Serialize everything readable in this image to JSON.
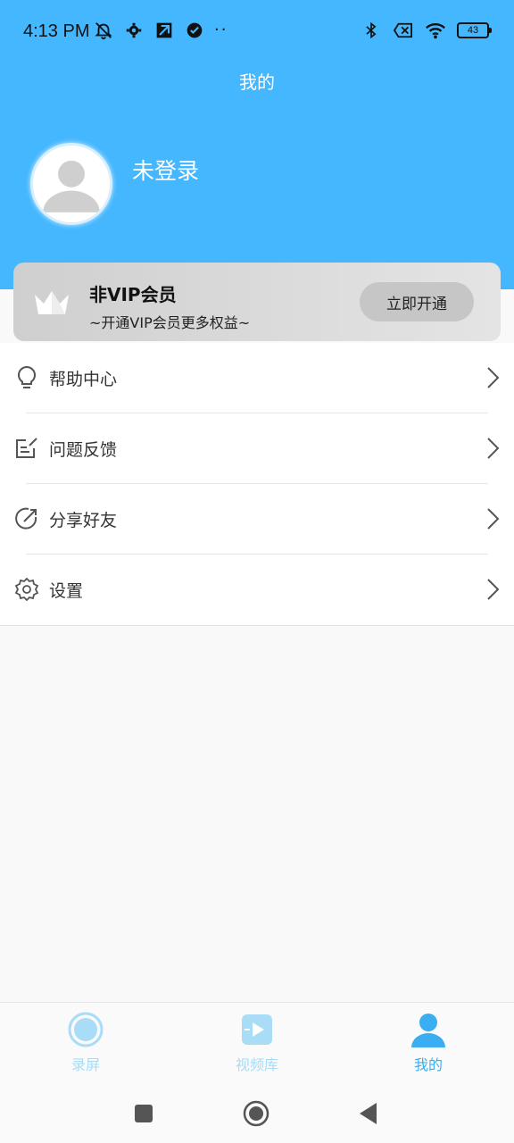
{
  "status_bar": {
    "time": "4:13 PM",
    "left_icons": [
      "muted-bell-icon",
      "gear-icon",
      "app-icon",
      "check-badge-icon"
    ],
    "dots": "··",
    "right_icons": [
      "bluetooth-icon",
      "sim-off-icon",
      "wifi-icon"
    ],
    "battery": "43"
  },
  "header": {
    "title": "我的",
    "background_color": "#44b7ff"
  },
  "profile": {
    "login_label": "未登录"
  },
  "vip": {
    "title": "非VIP会员",
    "subtitle": "~开通VIP会员更多权益~",
    "button_label": "立即开通"
  },
  "menu": {
    "items": [
      {
        "label": "帮助中心",
        "icon": "lightbulb-icon"
      },
      {
        "label": "问题反馈",
        "icon": "feedback-icon"
      },
      {
        "label": "分享好友",
        "icon": "share-icon"
      },
      {
        "label": "设置",
        "icon": "gear-icon"
      }
    ]
  },
  "tabbar": {
    "tabs": [
      {
        "label": "录屏",
        "icon": "record-icon",
        "active": false
      },
      {
        "label": "视频库",
        "icon": "video-library-icon",
        "active": false
      },
      {
        "label": "我的",
        "icon": "profile-icon",
        "active": true
      }
    ],
    "active_color": "#3aaef0",
    "inactive_color": "#a8dcf7"
  },
  "navbar": {
    "buttons": [
      "recents-icon",
      "home-icon",
      "back-icon"
    ]
  }
}
